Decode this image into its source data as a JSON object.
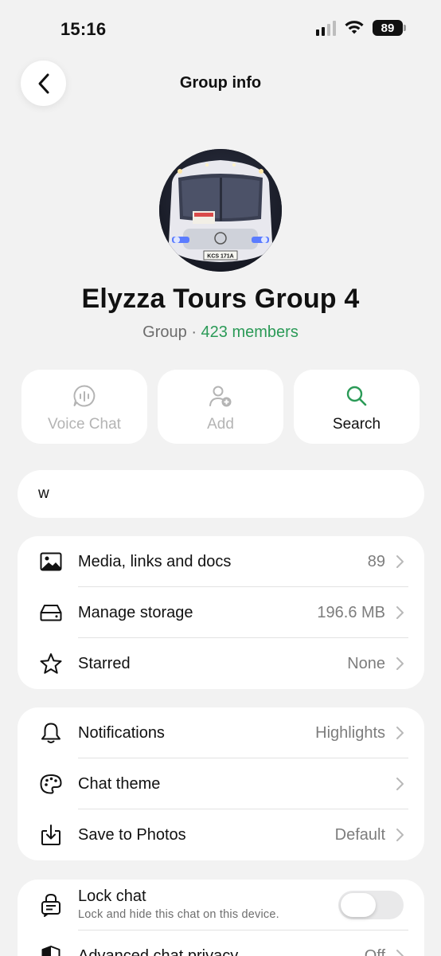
{
  "status_bar": {
    "time": "15:16",
    "battery": "89",
    "icons": [
      "signal-icon",
      "wifi-icon",
      "battery-icon"
    ]
  },
  "header": {
    "title": "Group info",
    "back_icon": "chevron-left-icon"
  },
  "profile": {
    "name": "Elyzza Tours Group 4",
    "type_label": "Group",
    "separator": " · ",
    "members": "423 members",
    "avatar_plate": "KCS 171A"
  },
  "actions": [
    {
      "label": "Voice Chat",
      "icon": "voice-chat-icon",
      "enabled": false
    },
    {
      "label": "Add",
      "icon": "add-person-icon",
      "enabled": false
    },
    {
      "label": "Search",
      "icon": "search-icon",
      "enabled": true
    }
  ],
  "description": {
    "text": "w"
  },
  "media_section": [
    {
      "label": "Media, links and docs",
      "value": "89",
      "icon": "image-icon"
    },
    {
      "label": "Manage storage",
      "value": "196.6 MB",
      "icon": "storage-icon"
    },
    {
      "label": "Starred",
      "value": "None",
      "icon": "star-icon"
    }
  ],
  "settings_section": [
    {
      "label": "Notifications",
      "value": "Highlights",
      "icon": "bell-icon"
    },
    {
      "label": "Chat theme",
      "value": "",
      "icon": "palette-icon"
    },
    {
      "label": "Save to Photos",
      "value": "Default",
      "icon": "download-icon"
    }
  ],
  "privacy_section": {
    "lock_title": "Lock chat",
    "lock_subtitle": "Lock and hide this chat on this device.",
    "lock_enabled": false,
    "advanced_label": "Advanced chat privacy",
    "advanced_value": "Off"
  },
  "colors": {
    "accent_green": "#2b9a57",
    "background": "#f2f2f2",
    "card": "#ffffff",
    "muted_text": "#7d7d7d",
    "disabled_text": "#b4b4b4"
  }
}
